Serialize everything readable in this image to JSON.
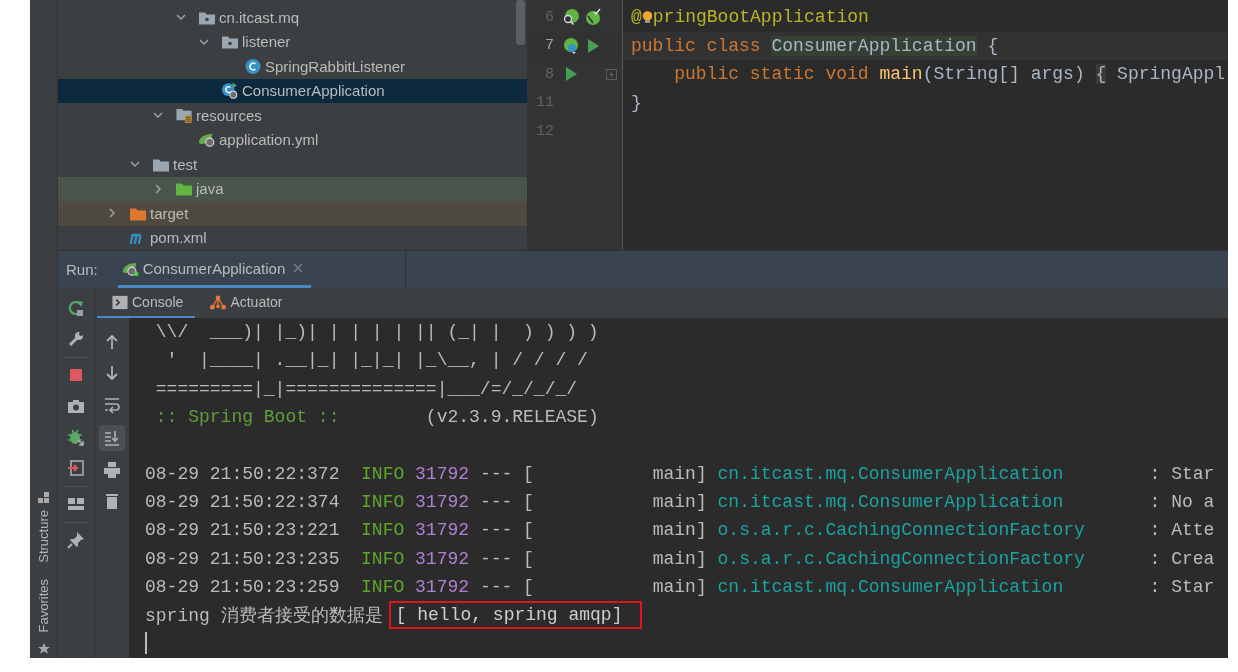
{
  "tree": [
    {
      "children": [
        {
          "children": [
            {
              "children": [
                {
                  "label": "cn.itcast.mq",
                  "kind": "package",
                  "expanded": true,
                  "selected": false,
                  "children": [
                    {
                      "label": "listener",
                      "kind": "package",
                      "expanded": true,
                      "selected": false,
                      "children": [
                        {
                          "label": "SpringRabbitListener",
                          "kind": "class",
                          "selected": false
                        }
                      ]
                    },
                    {
                      "label": "ConsumerApplication",
                      "kind": "spring-class",
                      "selected": true
                    }
                  ]
                }
              ]
            },
            {
              "label": "resources",
              "kind": "resources",
              "expanded": true,
              "selected": false,
              "children": [
                {
                  "label": "application.yml",
                  "kind": "yml",
                  "selected": false
                }
              ]
            }
          ]
        },
        {
          "label": "test",
          "kind": "folder",
          "expanded": true,
          "selected": false,
          "children": [
            {
              "label": "java",
              "kind": "test-source",
              "expanded": false,
              "selected": false
            }
          ]
        }
      ]
    },
    {
      "label": "target",
      "kind": "excluded",
      "expanded": false,
      "selected": false
    },
    {
      "label": "pom.xml",
      "kind": "maven",
      "selected": false
    }
  ],
  "editor": {
    "lines": [
      {
        "number": "6",
        "current": false,
        "bulb": true,
        "foldable": false,
        "tokens": [
          {
            "kind": "annotation",
            "text": "@"
          },
          {
            "kind": "annotation",
            "text": "pringBootApplication"
          }
        ]
      },
      {
        "number": "7",
        "current": true,
        "bulb": false,
        "foldable": false,
        "tokens": [
          {
            "kind": "keyword",
            "text": "public class "
          },
          {
            "kind": "declaration",
            "text": "ConsumerApplication"
          },
          {
            "kind": "plain",
            "text": " {"
          }
        ]
      },
      {
        "number": "8",
        "current": false,
        "bulb": false,
        "foldable": true,
        "tokens": [
          {
            "kind": "keyword",
            "text": "    public static void "
          },
          {
            "kind": "method",
            "text": "main"
          },
          {
            "kind": "plain",
            "text": "(String[] args) "
          },
          {
            "kind": "folded",
            "text": "{"
          },
          {
            "kind": "plain",
            "text": " SpringAppl"
          }
        ]
      },
      {
        "number": "11",
        "current": false,
        "bulb": false,
        "foldable": false,
        "tokens": [
          {
            "kind": "plain",
            "text": "}"
          }
        ]
      },
      {
        "number": "12",
        "current": false,
        "bulb": false,
        "foldable": false
      }
    ]
  },
  "run_bar": {
    "label": "Run:",
    "tabs": [
      {
        "label": "ConsumerApplication",
        "selected": true,
        "closable": true
      }
    ]
  },
  "console_tabs": [
    {
      "label": "Console",
      "kind": "console",
      "selected": true
    },
    {
      "label": "Actuator",
      "kind": "actuator",
      "selected": false
    }
  ],
  "console_toolbar": {
    "soft_wrap": false,
    "scroll_to_end": true
  },
  "side_tabs": [
    "Structure",
    "Favorites"
  ],
  "console": {
    "cursor": true,
    "lines": [
      {
        "kind": "text",
        "segments": [
          {
            "kind": "plain",
            "text": " \\\\/  ___)| |_)| | | | | || (_| |  ) ) ) )"
          }
        ]
      },
      {
        "kind": "text",
        "segments": [
          {
            "kind": "plain",
            "text": "  '  |____| .__|_| |_|_| |_\\__, | / / / /"
          }
        ]
      },
      {
        "kind": "text",
        "segments": [
          {
            "kind": "plain",
            "text": " =========|_|==============|___/=/_/_/_/"
          }
        ]
      },
      {
        "kind": "text",
        "segments": [
          {
            "kind": "banner",
            "text": " :: Spring Boot ::"
          },
          {
            "kind": "plain",
            "text": "        (v2.3.9.RELEASE)"
          }
        ]
      },
      {
        "kind": "blank"
      },
      {
        "kind": "text",
        "segments": [
          {
            "kind": "plain",
            "text": "08-29 21:50:22:372  "
          },
          {
            "kind": "level",
            "text": "INFO"
          },
          {
            "kind": "pid",
            "text": "31792"
          },
          {
            "kind": "plain",
            "text": " --- [           main] "
          },
          {
            "kind": "logger",
            "text": "cn.itcast.mq.ConsumerApplication"
          },
          {
            "kind": "plain",
            "text": "        : Star"
          }
        ]
      },
      {
        "kind": "text",
        "segments": [
          {
            "kind": "plain",
            "text": "08-29 21:50:22:374  "
          },
          {
            "kind": "level",
            "text": "INFO"
          },
          {
            "kind": "pid",
            "text": "31792"
          },
          {
            "kind": "plain",
            "text": " --- [           main] "
          },
          {
            "kind": "logger",
            "text": "cn.itcast.mq.ConsumerApplication"
          },
          {
            "kind": "plain",
            "text": "        : No a"
          }
        ]
      },
      {
        "kind": "text",
        "segments": [
          {
            "kind": "plain",
            "text": "08-29 21:50:23:221  "
          },
          {
            "kind": "level",
            "text": "INFO"
          },
          {
            "kind": "pid",
            "text": "31792"
          },
          {
            "kind": "plain",
            "text": " --- [           main] "
          },
          {
            "kind": "logger",
            "text": "o.s.a.r.c.CachingConnectionFactory"
          },
          {
            "kind": "plain",
            "text": "      : Atte"
          }
        ]
      },
      {
        "kind": "text",
        "segments": [
          {
            "kind": "plain",
            "text": "08-29 21:50:23:235  "
          },
          {
            "kind": "level",
            "text": "INFO"
          },
          {
            "kind": "pid",
            "text": "31792"
          },
          {
            "kind": "plain",
            "text": " --- [           main] "
          },
          {
            "kind": "logger",
            "text": "o.s.a.r.c.CachingConnectionFactory"
          },
          {
            "kind": "plain",
            "text": "      : Crea"
          }
        ]
      },
      {
        "kind": "text",
        "segments": [
          {
            "kind": "plain",
            "text": "08-29 21:50:23:259  "
          },
          {
            "kind": "level",
            "text": "INFO"
          },
          {
            "kind": "pid",
            "text": "31792"
          },
          {
            "kind": "plain",
            "text": " --- [           main] "
          },
          {
            "kind": "logger",
            "text": "cn.itcast.mq.ConsumerApplication"
          },
          {
            "kind": "plain",
            "text": "        : Star"
          }
        ]
      },
      {
        "kind": "output",
        "segments": [
          {
            "kind": "plain",
            "text": "spring 消费者接受的数据是"
          },
          {
            "kind": "boxed",
            "text": "[ hello, spring amqp]"
          }
        ]
      }
    ]
  }
}
